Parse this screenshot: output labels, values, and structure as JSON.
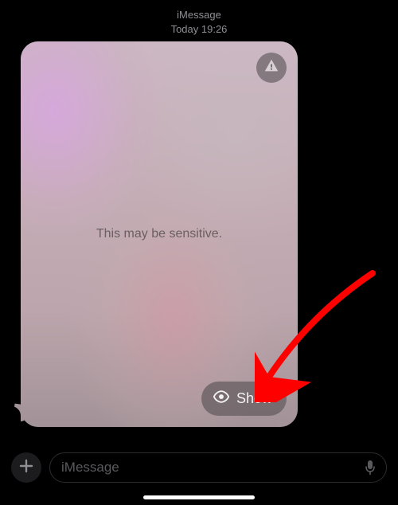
{
  "header": {
    "service": "iMessage",
    "timestamp": "Today 19:26"
  },
  "message": {
    "sensitive_label": "This may be sensitive.",
    "show_label": "Show"
  },
  "input": {
    "placeholder": "iMessage"
  },
  "icons": {
    "warning": "warning-triangle",
    "eye": "eye",
    "plus": "plus",
    "mic": "microphone"
  }
}
